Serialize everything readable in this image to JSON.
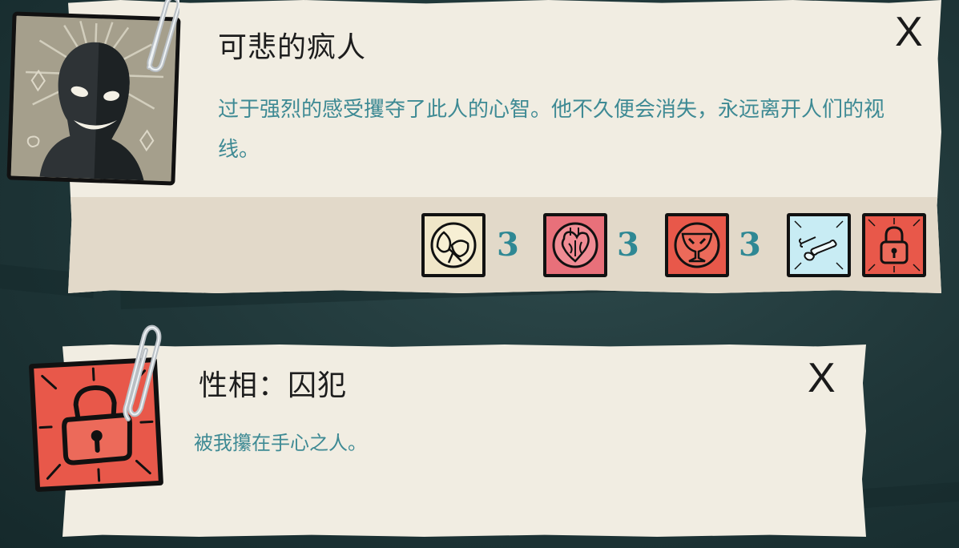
{
  "card1": {
    "title": "可悲的疯人",
    "description": "过于强烈的感受攫夺了此人的心智。他不久便会消失，永远离开人们的视线。",
    "close_label": "X",
    "aspects": [
      {
        "icon": "moth-icon",
        "color": "#f0e6c8",
        "count": "3"
      },
      {
        "icon": "heart-icon",
        "color": "#e8707a",
        "count": "3"
      },
      {
        "icon": "grail-icon",
        "color": "#e8584a",
        "count": "3"
      },
      {
        "icon": "bones-icon",
        "color": "#c8ecf4",
        "count": ""
      },
      {
        "icon": "padlock-icon",
        "color": "#e8584a",
        "count": ""
      }
    ]
  },
  "card2": {
    "title": "性相：囚犯",
    "description": "被我攥在手心之人。",
    "close_label": "X",
    "icon": "padlock-icon",
    "icon_color": "#e8584a"
  },
  "colors": {
    "paper": "#f1ede2",
    "paper_strip": "#e2d9c9",
    "description_text": "#3e8a94",
    "number_text": "#2f8894",
    "background": "#1f3638"
  }
}
